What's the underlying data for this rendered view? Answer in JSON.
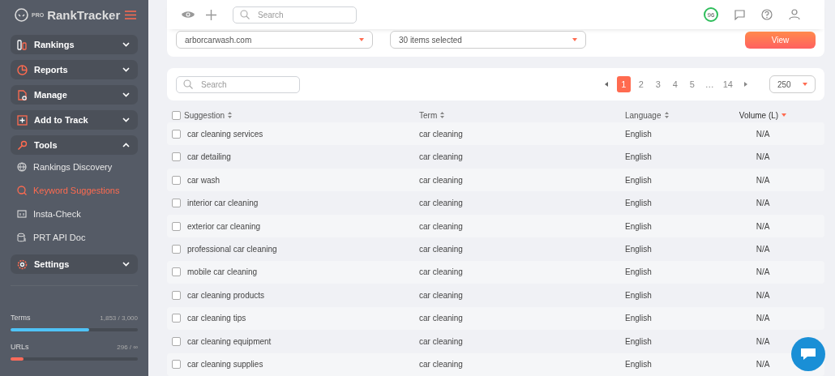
{
  "sidebar": {
    "logo": {
      "prefix": "PRO",
      "name": "RankTracker"
    },
    "nav": [
      {
        "kind": "group",
        "label": "Rankings",
        "expanded": false
      },
      {
        "kind": "group",
        "label": "Reports",
        "expanded": false
      },
      {
        "kind": "group",
        "label": "Manage",
        "expanded": false
      },
      {
        "kind": "group",
        "label": "Add to Track",
        "expanded": false
      },
      {
        "kind": "group",
        "label": "Tools",
        "expanded": true,
        "children": [
          {
            "label": "Rankings Discovery",
            "selected": false
          },
          {
            "label": "Keyword Suggestions",
            "selected": true
          },
          {
            "label": "Insta-Check",
            "selected": false
          },
          {
            "label": "PRT API Doc",
            "selected": false
          }
        ]
      },
      {
        "kind": "group",
        "label": "Settings",
        "expanded": false
      }
    ],
    "usage": [
      {
        "label": "Terms",
        "reading": "1,853 / 3,000",
        "level": 0.62,
        "color": "#4fc3f7"
      },
      {
        "label": "URLs",
        "reading": "296 / ∞",
        "level": 0.1,
        "color": "#ff6b5b"
      }
    ]
  },
  "toolbar": {
    "search": {
      "placeholder": "Search"
    },
    "score": "96"
  },
  "filters": {
    "domain": "arborcarwash.com",
    "terms": "30 items selected",
    "button": "View"
  },
  "table": {
    "search": {
      "placeholder": "Search"
    },
    "pages": [
      {
        "label": "1",
        "selected": true
      },
      {
        "label": "2",
        "selected": false
      },
      {
        "label": "3",
        "selected": false
      },
      {
        "label": "4",
        "selected": false
      },
      {
        "label": "5",
        "selected": false
      },
      {
        "label": "…",
        "selected": false
      },
      {
        "label": "14",
        "selected": false
      }
    ],
    "per_page": "250",
    "select_all_checked": false,
    "columns": [
      {
        "label": "Suggestion",
        "sorted": false
      },
      {
        "label": "Term",
        "sorted": false
      },
      {
        "label": "Language",
        "sorted": false
      },
      {
        "label": "Volume (L)",
        "sorted": true
      }
    ],
    "rows": [
      {
        "cells": [
          "car cleaning services",
          "car cleaning",
          "English",
          "N/A"
        ],
        "checked": false
      },
      {
        "cells": [
          "car detailing",
          "car cleaning",
          "English",
          "N/A"
        ],
        "checked": false
      },
      {
        "cells": [
          "car wash",
          "car cleaning",
          "English",
          "N/A"
        ],
        "checked": false
      },
      {
        "cells": [
          "interior car cleaning",
          "car cleaning",
          "English",
          "N/A"
        ],
        "checked": false
      },
      {
        "cells": [
          "exterior car cleaning",
          "car cleaning",
          "English",
          "N/A"
        ],
        "checked": false
      },
      {
        "cells": [
          "professional car cleaning",
          "car cleaning",
          "English",
          "N/A"
        ],
        "checked": false
      },
      {
        "cells": [
          "mobile car cleaning",
          "car cleaning",
          "English",
          "N/A"
        ],
        "checked": false
      },
      {
        "cells": [
          "car cleaning products",
          "car cleaning",
          "English",
          "N/A"
        ],
        "checked": false
      },
      {
        "cells": [
          "car cleaning tips",
          "car cleaning",
          "English",
          "N/A"
        ],
        "checked": false
      },
      {
        "cells": [
          "car cleaning equipment",
          "car cleaning",
          "English",
          "N/A"
        ],
        "checked": false
      },
      {
        "cells": [
          "car cleaning supplies",
          "car cleaning",
          "English",
          "N/A"
        ],
        "checked": false
      }
    ]
  }
}
